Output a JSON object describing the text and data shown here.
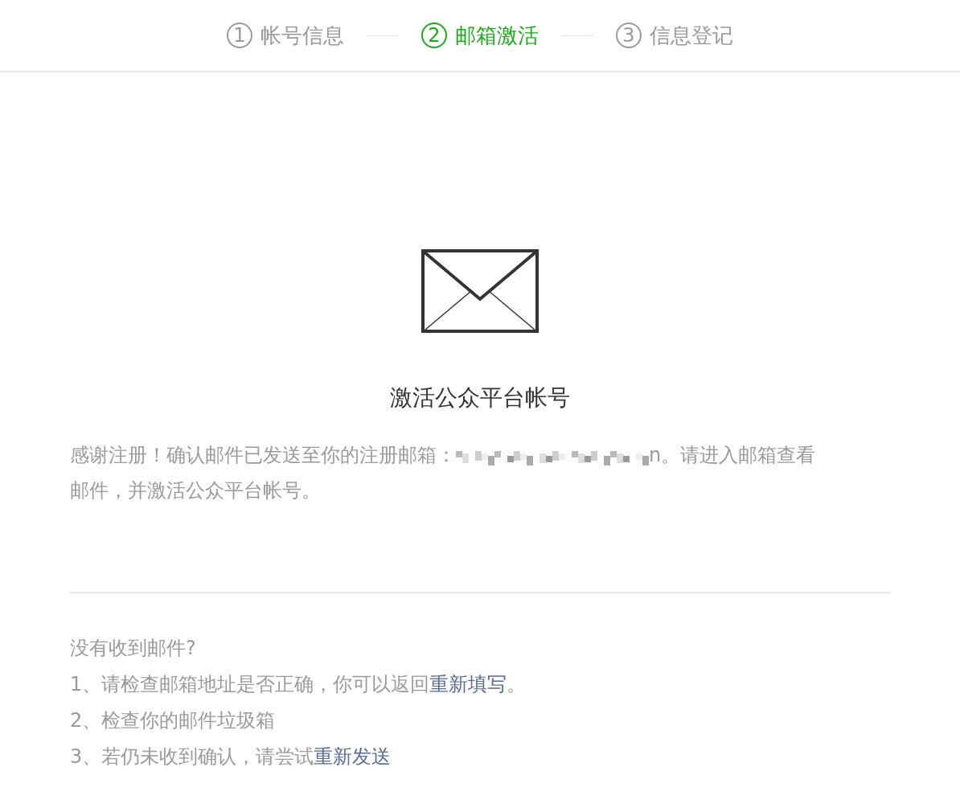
{
  "steps": [
    {
      "number": "1",
      "label": "帐号信息",
      "selected": false
    },
    {
      "number": "2",
      "label": "邮箱激活",
      "selected": true
    },
    {
      "number": "3",
      "label": "信息登记",
      "selected": false
    }
  ],
  "title": "激活公众平台帐号",
  "message": {
    "text_before": "感谢注册！确认邮件已发送至你的注册邮箱：",
    "line_1_end": "n。请进入邮箱查看",
    "line_2": "邮件，并激活公众平台帐号。"
  },
  "help": {
    "heading": "没有收到邮件?",
    "lines": [
      {
        "text": "1、请检查邮箱地址是否正确，你可以返回",
        "link": "重新填写",
        "after": "。"
      },
      {
        "text": "2、检查你的邮件垃圾箱"
      },
      {
        "text": "3、若仍未收到确认，请尝试",
        "link": "重新发送"
      }
    ]
  }
}
